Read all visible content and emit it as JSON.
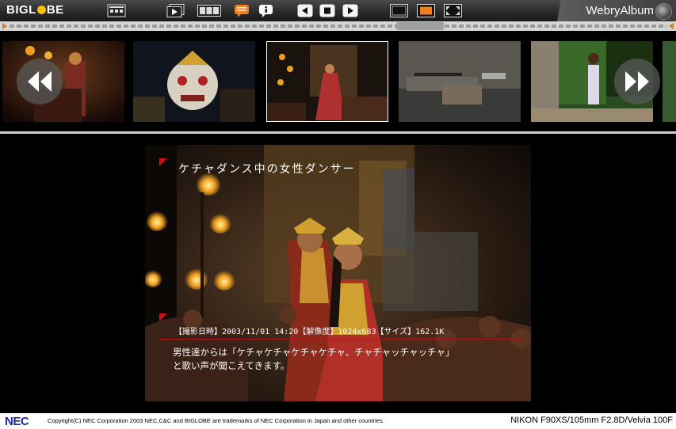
{
  "toolbar": {
    "logo_text": "BIGLOBE",
    "brand": "WebryAlbum",
    "buttons": [
      "thumbnail-list-icon",
      "slideshow-icon",
      "filmstrip-icon",
      "comment-icon",
      "info-icon",
      "previous-icon",
      "stop-icon",
      "next-icon",
      "view-normal-icon",
      "view-medium-icon",
      "view-fullscreen-icon"
    ],
    "accent_color": "#e07a10"
  },
  "strip": {
    "thumbnails": [
      "kecak-fire-dancers",
      "barong-mask-dancer",
      "kecak-female-dancer",
      "workshop-tools",
      "girl-in-garden",
      "partial-thumbnail"
    ],
    "selected_index": 2
  },
  "photo": {
    "caption": "ケチャダンス中の女性ダンサー",
    "metadata": "【撮影日時】2003/11/01 14:20【解像度】1024x683【サイズ】162.1K",
    "description_line1": "男性達からは「ケチャケチャケチャケチャ、チャチャッチャッチャ」",
    "description_line2": "と歌い声が聞こえてきます。"
  },
  "footer": {
    "nec_logo": "NEC",
    "copyright": "Copyright(C) NEC Corporation 2003 NEC,C&C and BIGLOBE are trademarks of NEC Corporation in Japan and other countries.",
    "camera_info": "NIKON F90XS/105mm F2.8D/Velvia 100F"
  }
}
